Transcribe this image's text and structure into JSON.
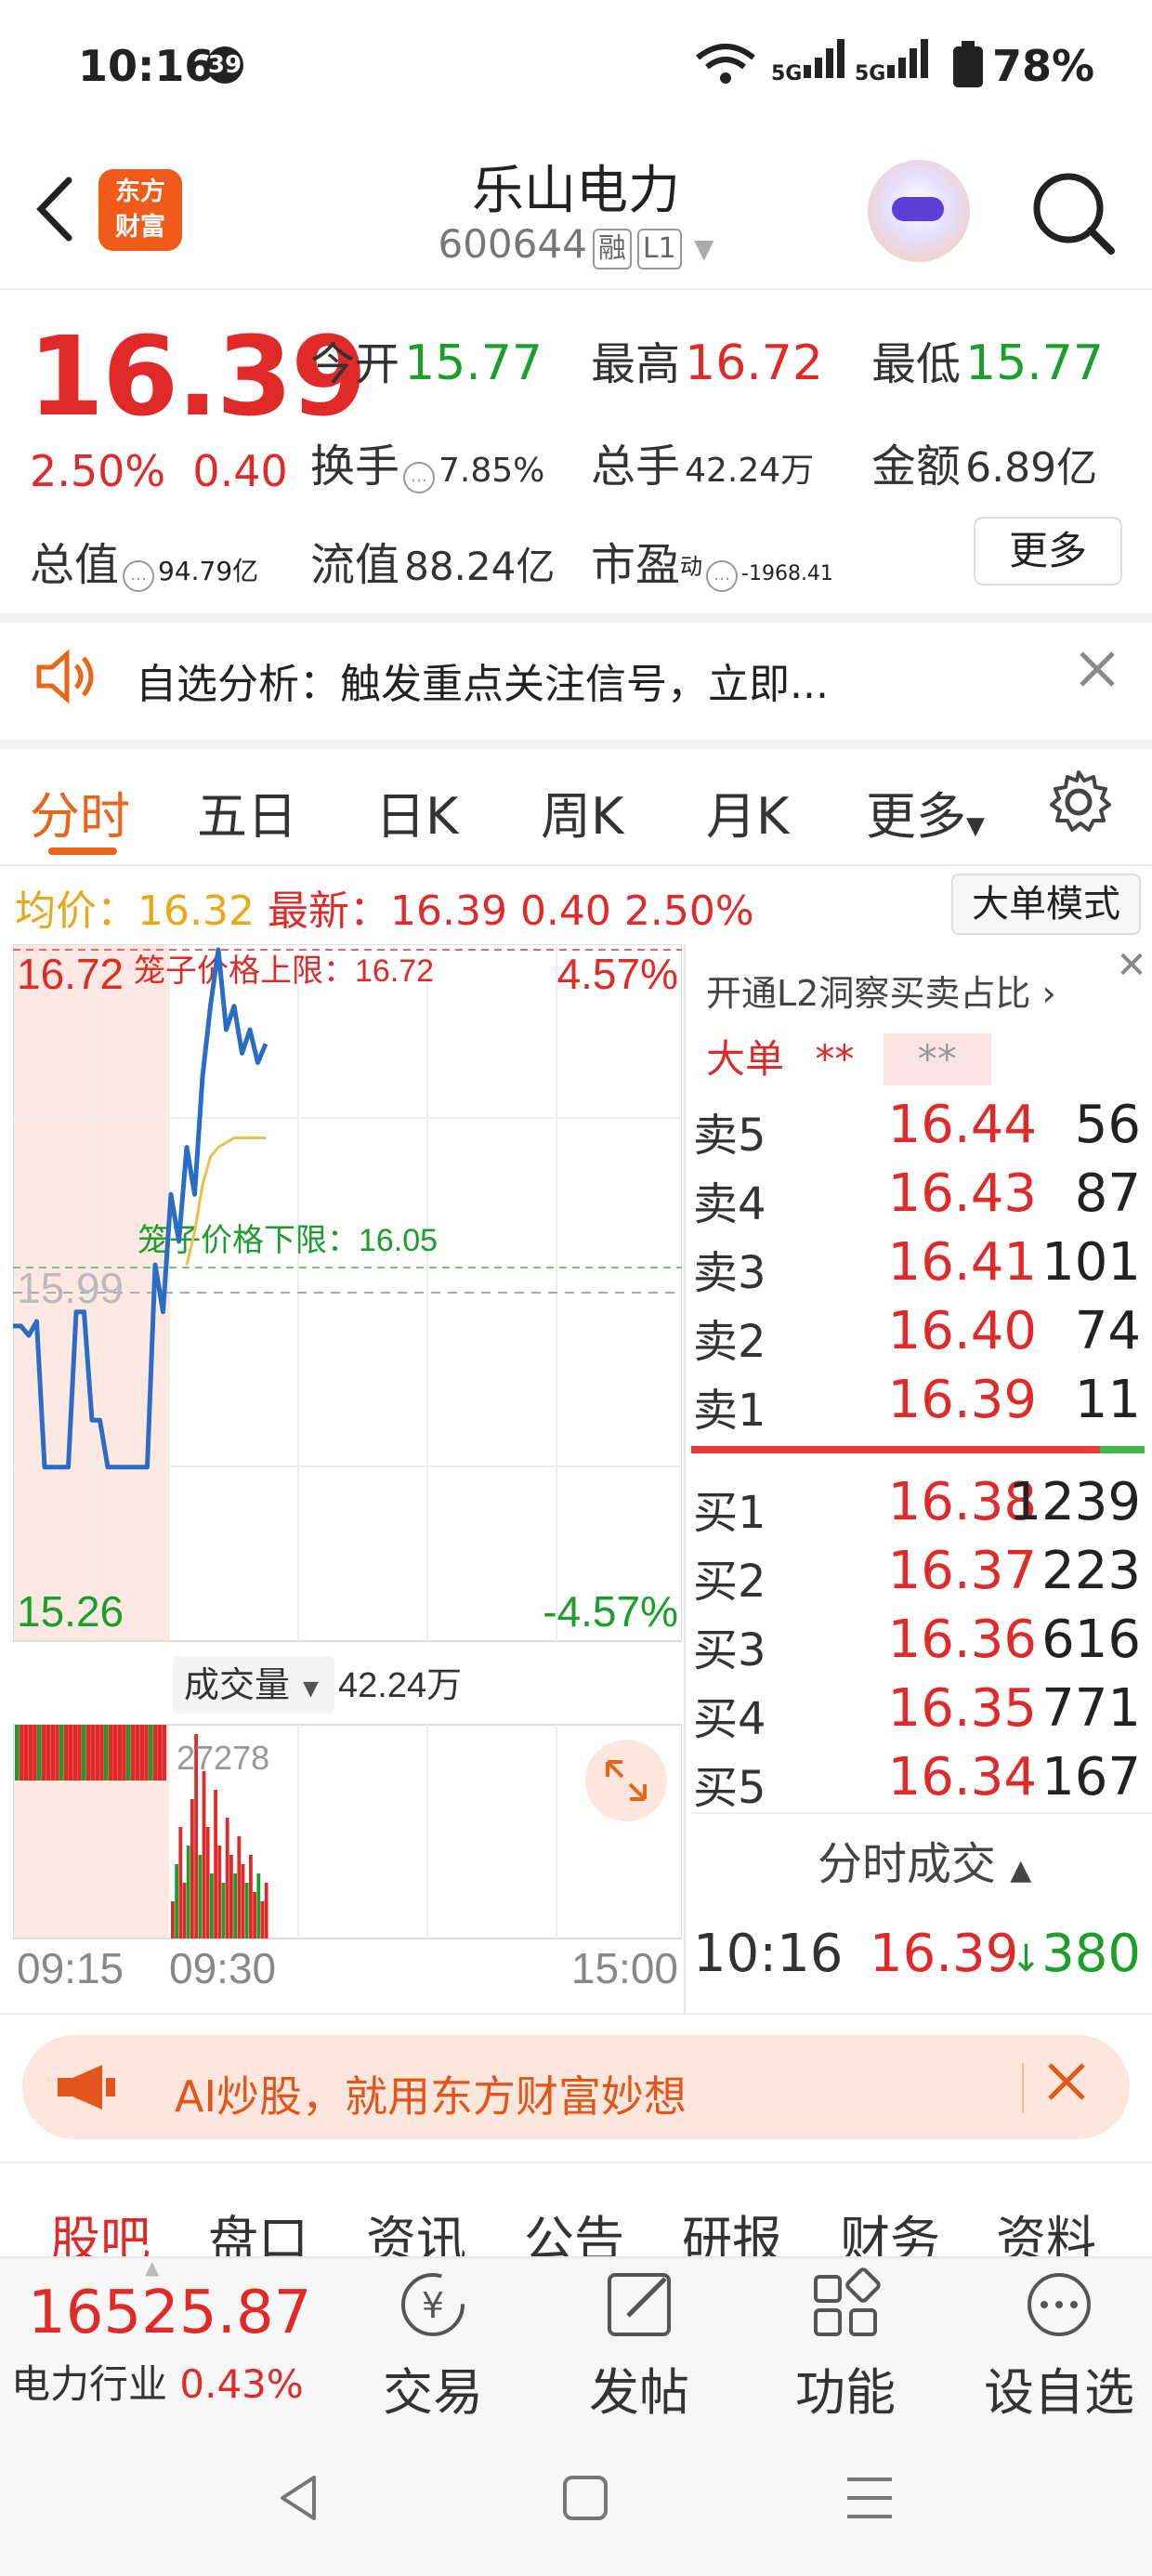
{
  "status_bar": {
    "time": "10:16",
    "badge": "39",
    "right": "5G 5G 78%"
  },
  "header": {
    "logo_line1": "东方",
    "logo_line2": "财富",
    "stock_name": "乐山电力",
    "stock_code": "600644",
    "tag_margin": "融",
    "tag_level": "L1"
  },
  "quote": {
    "price": "16.39",
    "change_pct": "2.50%",
    "change_abs": "0.40",
    "open_label": "今开",
    "open": "15.77",
    "high_label": "最高",
    "high": "16.72",
    "low_label": "最低",
    "low": "15.77",
    "turnover_label": "换手",
    "turnover": "7.85%",
    "volume_label": "总手",
    "volume": "42.24万",
    "amount_label": "金额",
    "amount": "6.89亿",
    "mktcap_label": "总值",
    "mktcap": "94.79亿",
    "float_label": "流值",
    "float": "88.24亿",
    "pe_label": "市盈",
    "pe_sup": "动",
    "pe": "-1968.41",
    "more_button": "更多"
  },
  "notice": {
    "text": "自选分析：触发重点关注信号，立即..."
  },
  "tabs": [
    "分时",
    "五日",
    "日K",
    "周K",
    "月K",
    "更多"
  ],
  "info_line": {
    "avg_label": "均价：",
    "avg": "16.32",
    "latest_label": "最新：",
    "latest": "16.39",
    "chg": "0.40",
    "pct": "2.50%",
    "big_order_mode": "大单模式"
  },
  "chart_data": {
    "type": "line",
    "title": "",
    "price_high": "16.72",
    "price_low": "15.26",
    "pct_high": "4.57%",
    "pct_low": "-4.57%",
    "prev_close": "15.99",
    "upper_limit_label": "笼子价格上限：16.72",
    "lower_limit_label": "笼子价格下限：16.05",
    "x_ticks": [
      "09:15",
      "09:30",
      "15:00"
    ],
    "ylim": [
      15.26,
      16.72
    ],
    "price_series": {
      "name": "最新",
      "values": [
        15.92,
        15.92,
        15.9,
        15.93,
        15.62,
        15.62,
        15.62,
        15.62,
        15.95,
        15.95,
        15.72,
        15.72,
        15.62,
        15.62,
        15.62,
        15.62,
        15.62,
        15.62,
        16.05,
        15.95,
        16.2,
        16.1,
        16.3,
        16.2,
        16.45,
        16.6,
        16.72,
        16.55,
        16.6,
        16.5,
        16.55,
        16.48,
        16.52
      ]
    },
    "avg_series": {
      "name": "均价",
      "values": [
        null,
        null,
        null,
        null,
        null,
        null,
        null,
        null,
        null,
        null,
        null,
        null,
        null,
        null,
        null,
        null,
        null,
        null,
        null,
        null,
        null,
        null,
        16.05,
        16.12,
        16.22,
        16.28,
        16.3,
        16.31,
        16.32,
        16.32,
        16.32,
        16.32,
        16.32
      ]
    },
    "volume_label": "成交量",
    "volume_total": "42.24万",
    "volume_max_label": "27278"
  },
  "order_book": {
    "promo": "开通L2洞察买卖占比",
    "big_order": "大单",
    "big_order_val1": "**",
    "big_order_val2": "**",
    "asks": [
      {
        "label": "卖5",
        "price": "16.44",
        "vol": "56"
      },
      {
        "label": "卖4",
        "price": "16.43",
        "vol": "87"
      },
      {
        "label": "卖3",
        "price": "16.41",
        "vol": "101"
      },
      {
        "label": "卖2",
        "price": "16.40",
        "vol": "74"
      },
      {
        "label": "卖1",
        "price": "16.39",
        "vol": "11"
      }
    ],
    "bids": [
      {
        "label": "买1",
        "price": "16.38",
        "vol": "1239"
      },
      {
        "label": "买2",
        "price": "16.37",
        "vol": "223"
      },
      {
        "label": "买3",
        "price": "16.36",
        "vol": "616"
      },
      {
        "label": "买4",
        "price": "16.35",
        "vol": "771"
      },
      {
        "label": "买5",
        "price": "16.34",
        "vol": "167"
      }
    ],
    "tick_title": "分时成交",
    "tick_time": "10:16",
    "tick_price": "16.39",
    "tick_vol": "380"
  },
  "ai_banner": {
    "text": "AI炒股，就用东方财富妙想"
  },
  "bottom_tabs": [
    "股吧",
    "盘口",
    "资讯",
    "公告",
    "研报",
    "财务",
    "资料"
  ],
  "bottom_bar": {
    "index_value": "16525.87",
    "index_name": "电力行业",
    "index_pct": "0.43%",
    "actions": [
      "交易",
      "发帖",
      "功能",
      "设自选"
    ]
  },
  "colors": {
    "up": "#e02a2a",
    "down": "#1b9e2b",
    "accent": "#e8651a",
    "line": "#2b6cc4"
  }
}
